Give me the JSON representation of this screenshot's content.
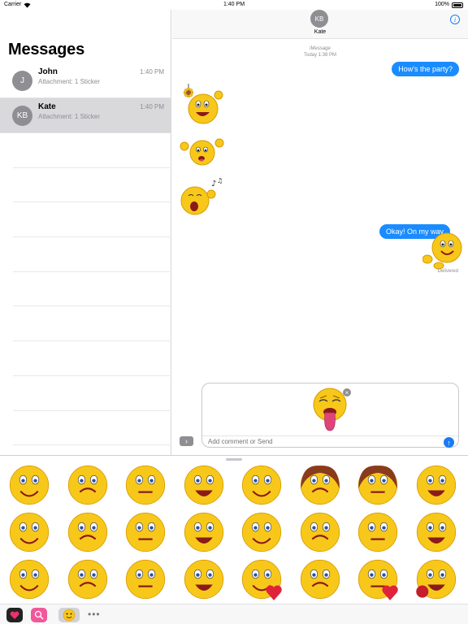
{
  "status": {
    "carrier": "Carrier",
    "time": "1:40 PM",
    "battery": "100%"
  },
  "sidebar": {
    "title": "Messages",
    "conversations": [
      {
        "initials": "J",
        "name": "John",
        "preview": "Attachment: 1 Sticker",
        "time": "1:40 PM"
      },
      {
        "initials": "KB",
        "name": "Kate",
        "preview": "Attachment: 1 Sticker",
        "time": "1:40 PM"
      }
    ]
  },
  "chat": {
    "contact_initials": "KB",
    "contact_name": "Kate",
    "info_icon": "i",
    "service": "iMessage",
    "timestamp": "Today 1:38 PM",
    "messages": [
      {
        "from": "me",
        "text": "How's the party?"
      },
      {
        "from": "them",
        "sticker": "sunflower-emoji-sticker"
      },
      {
        "from": "them",
        "sticker": "shrug-emoji-sticker"
      },
      {
        "from": "them",
        "sticker": "singing-emoji-sticker"
      },
      {
        "from": "me",
        "text": "Okay! On my way"
      }
    ],
    "delivered": "Delivered"
  },
  "composer": {
    "placeholder": "Add comment or Send",
    "expand_glyph": "›",
    "send_glyph": "↑",
    "remove_glyph": "×",
    "staged_sticker": "tongue-out-emoji-sticker"
  },
  "drawer": {
    "stickers": [
      "detective-emoji",
      "shocked-emoji",
      "bandaged-emoji",
      "binoculars-emoji",
      "praying-emoji",
      "nurse-emoji",
      "queen-emoji",
      "grinning-emoji",
      "laughing-emoji",
      "wink-tongue-emoji",
      "kiss-cheek-emoji",
      "waving-emoji",
      "covering-face-emoji",
      "hugging-emoji",
      "content-emoji",
      "drooling-emoji",
      "blushing-emoji",
      "confused-emoji",
      "pirate-emoji",
      "coffee-emoji",
      "heart-emoji",
      "flirt-emoji",
      "balloon-emoji",
      "rose-emoji"
    ],
    "more": "•••"
  },
  "colors": {
    "accent": "#1a8cff",
    "emoji_yellow": "#f7c81a",
    "selected_row": "#d9d9dc"
  }
}
